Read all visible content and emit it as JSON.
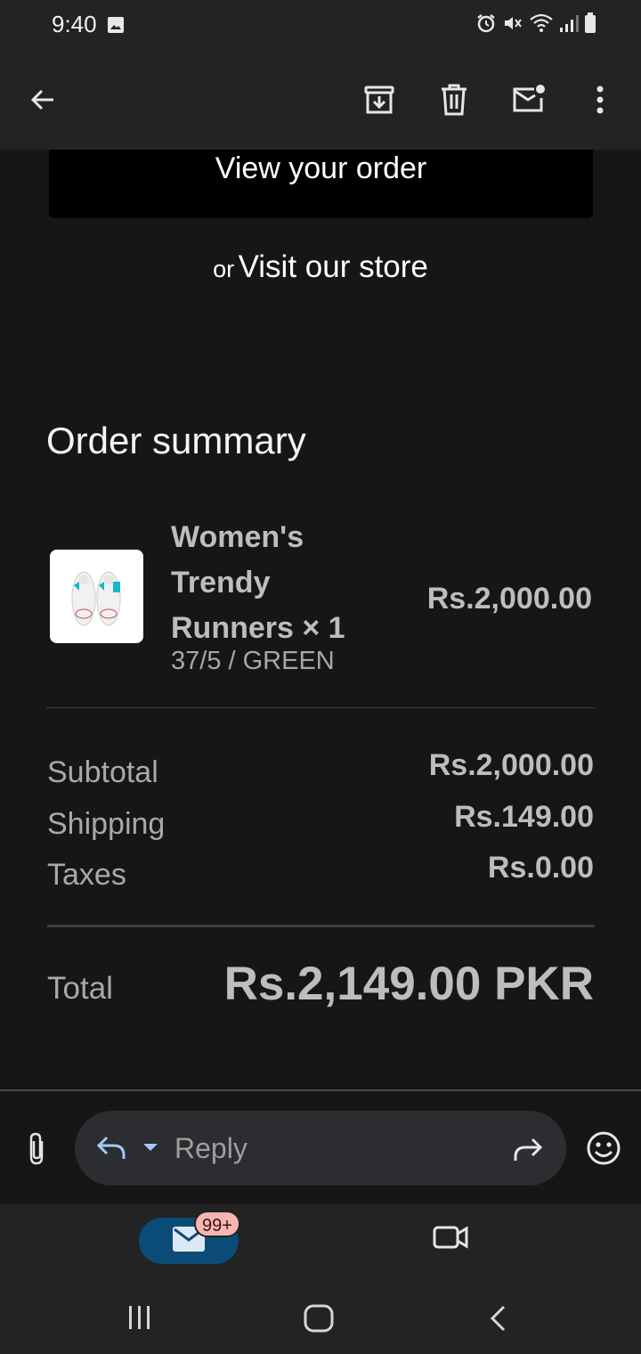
{
  "status_bar": {
    "time": "9:40",
    "icons": [
      "gallery-icon",
      "alarm-icon",
      "mute-icon",
      "wifi-icon",
      "signal-icon",
      "battery-icon"
    ]
  },
  "app_bar": {
    "icons": [
      "back-arrow-icon",
      "archive-icon",
      "trash-icon",
      "mark-unread-icon",
      "more-vert-icon"
    ]
  },
  "email": {
    "view_order_label": "View your order",
    "visit_store_prefix": "or",
    "visit_store_label": "Visit our store",
    "order_summary_title": "Order summary",
    "item": {
      "name": "Women's Trendy Runners × 1",
      "name_lines": [
        "Women's",
        "Trendy",
        "Runners × 1"
      ],
      "variant": "37/5 / GREEN",
      "price": "Rs.2,000.00"
    },
    "lines": [
      {
        "label": "Subtotal",
        "value": "Rs.2,000.00"
      },
      {
        "label": "Shipping",
        "value": "Rs.149.00"
      },
      {
        "label": "Taxes",
        "value": "Rs.0.00"
      }
    ],
    "total_label": "Total",
    "total_value": "Rs.2,149.00 PKR"
  },
  "reply_bar": {
    "placeholder": "Reply"
  },
  "bottom_nav": {
    "mail_badge": "99+"
  },
  "colors": {
    "background": "#161616",
    "bar": "#232323",
    "mail_pill": "#0b4b78",
    "badge": "#f5b5b3",
    "reply_accent": "#a8c7fa"
  }
}
